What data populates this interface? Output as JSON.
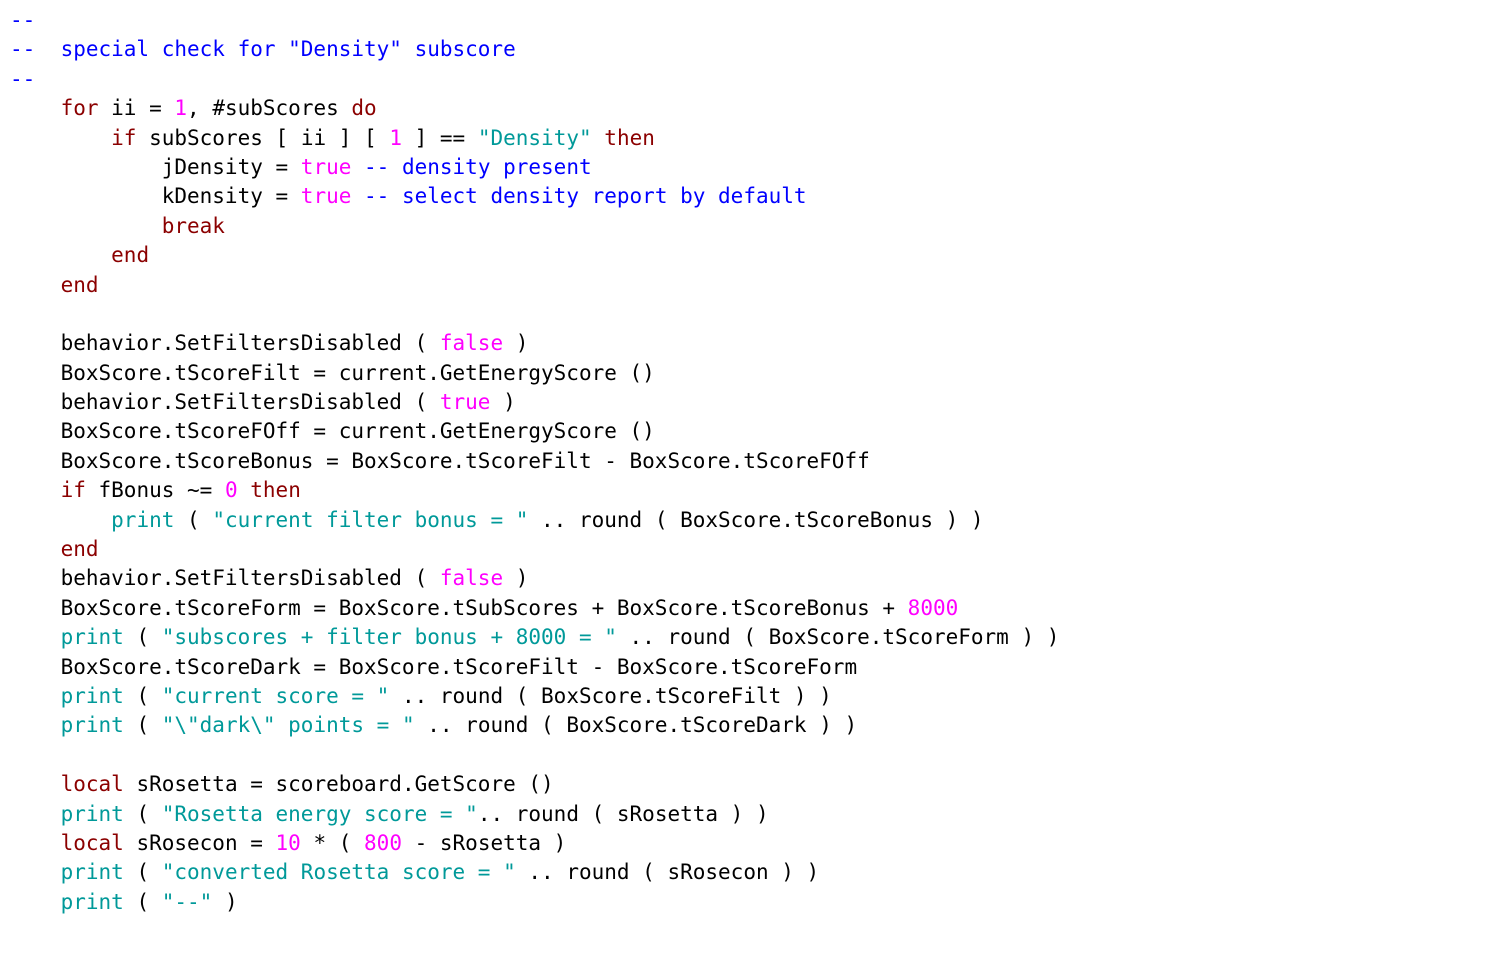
{
  "tokens": [
    {
      "cls": "c-blue",
      "text": "--"
    },
    {
      "br": true
    },
    {
      "cls": "c-blue",
      "text": "--  special check for \"Density\" subscore"
    },
    {
      "br": true
    },
    {
      "cls": "c-blue",
      "text": "--"
    },
    {
      "br": true
    },
    {
      "cls": "c-black",
      "text": "    "
    },
    {
      "cls": "c-brown",
      "text": "for"
    },
    {
      "cls": "c-black",
      "text": " ii = "
    },
    {
      "cls": "c-mag",
      "text": "1"
    },
    {
      "cls": "c-black",
      "text": ", #subScores "
    },
    {
      "cls": "c-brown",
      "text": "do"
    },
    {
      "br": true
    },
    {
      "cls": "c-black",
      "text": "        "
    },
    {
      "cls": "c-brown",
      "text": "if"
    },
    {
      "cls": "c-black",
      "text": " subScores [ ii ] [ "
    },
    {
      "cls": "c-mag",
      "text": "1"
    },
    {
      "cls": "c-black",
      "text": " ] == "
    },
    {
      "cls": "c-teal",
      "text": "\"Density\""
    },
    {
      "cls": "c-black",
      "text": " "
    },
    {
      "cls": "c-brown",
      "text": "then"
    },
    {
      "br": true
    },
    {
      "cls": "c-black",
      "text": "            jDensity = "
    },
    {
      "cls": "c-mag",
      "text": "true"
    },
    {
      "cls": "c-black",
      "text": " "
    },
    {
      "cls": "c-blue",
      "text": "-- density present"
    },
    {
      "br": true
    },
    {
      "cls": "c-black",
      "text": "            kDensity = "
    },
    {
      "cls": "c-mag",
      "text": "true"
    },
    {
      "cls": "c-black",
      "text": " "
    },
    {
      "cls": "c-blue",
      "text": "-- select density report by default"
    },
    {
      "br": true
    },
    {
      "cls": "c-black",
      "text": "            "
    },
    {
      "cls": "c-brown",
      "text": "break"
    },
    {
      "br": true
    },
    {
      "cls": "c-black",
      "text": "        "
    },
    {
      "cls": "c-brown",
      "text": "end"
    },
    {
      "br": true
    },
    {
      "cls": "c-black",
      "text": "    "
    },
    {
      "cls": "c-brown",
      "text": "end"
    },
    {
      "br": true
    },
    {
      "br": true
    },
    {
      "cls": "c-black",
      "text": "    behavior.SetFiltersDisabled ( "
    },
    {
      "cls": "c-mag",
      "text": "false"
    },
    {
      "cls": "c-black",
      "text": " )"
    },
    {
      "br": true
    },
    {
      "cls": "c-black",
      "text": "    BoxScore.tScoreFilt = current.GetEnergyScore ()"
    },
    {
      "br": true
    },
    {
      "cls": "c-black",
      "text": "    behavior.SetFiltersDisabled ( "
    },
    {
      "cls": "c-mag",
      "text": "true"
    },
    {
      "cls": "c-black",
      "text": " )"
    },
    {
      "br": true
    },
    {
      "cls": "c-black",
      "text": "    BoxScore.tScoreFOff = current.GetEnergyScore ()"
    },
    {
      "br": true
    },
    {
      "cls": "c-black",
      "text": "    BoxScore.tScoreBonus = BoxScore.tScoreFilt - BoxScore.tScoreFOff"
    },
    {
      "br": true
    },
    {
      "cls": "c-black",
      "text": "    "
    },
    {
      "cls": "c-brown",
      "text": "if"
    },
    {
      "cls": "c-black",
      "text": " fBonus ~= "
    },
    {
      "cls": "c-mag",
      "text": "0"
    },
    {
      "cls": "c-black",
      "text": " "
    },
    {
      "cls": "c-brown",
      "text": "then"
    },
    {
      "br": true
    },
    {
      "cls": "c-black",
      "text": "        "
    },
    {
      "cls": "c-teal",
      "text": "print"
    },
    {
      "cls": "c-black",
      "text": " ( "
    },
    {
      "cls": "c-teal",
      "text": "\"current filter bonus = \""
    },
    {
      "cls": "c-black",
      "text": " .. round ( BoxScore.tScoreBonus ) )"
    },
    {
      "br": true
    },
    {
      "cls": "c-black",
      "text": "    "
    },
    {
      "cls": "c-brown",
      "text": "end"
    },
    {
      "br": true
    },
    {
      "cls": "c-black",
      "text": "    behavior.SetFiltersDisabled ( "
    },
    {
      "cls": "c-mag",
      "text": "false"
    },
    {
      "cls": "c-black",
      "text": " )"
    },
    {
      "br": true
    },
    {
      "cls": "c-black",
      "text": "    BoxScore.tScoreForm = BoxScore.tSubScores + BoxScore.tScoreBonus + "
    },
    {
      "cls": "c-mag",
      "text": "8000"
    },
    {
      "br": true
    },
    {
      "cls": "c-black",
      "text": "    "
    },
    {
      "cls": "c-teal",
      "text": "print"
    },
    {
      "cls": "c-black",
      "text": " ( "
    },
    {
      "cls": "c-teal",
      "text": "\"subscores + filter bonus + 8000 = \""
    },
    {
      "cls": "c-black",
      "text": " .. round ( BoxScore.tScoreForm ) )"
    },
    {
      "br": true
    },
    {
      "cls": "c-black",
      "text": "    BoxScore.tScoreDark = BoxScore.tScoreFilt - BoxScore.tScoreForm"
    },
    {
      "br": true
    },
    {
      "cls": "c-black",
      "text": "    "
    },
    {
      "cls": "c-teal",
      "text": "print"
    },
    {
      "cls": "c-black",
      "text": " ( "
    },
    {
      "cls": "c-teal",
      "text": "\"current score = \""
    },
    {
      "cls": "c-black",
      "text": " .. round ( BoxScore.tScoreFilt ) )"
    },
    {
      "br": true
    },
    {
      "cls": "c-black",
      "text": "    "
    },
    {
      "cls": "c-teal",
      "text": "print"
    },
    {
      "cls": "c-black",
      "text": " ( "
    },
    {
      "cls": "c-teal",
      "text": "\"\\\"dark\\\" points = \""
    },
    {
      "cls": "c-black",
      "text": " .. round ( BoxScore.tScoreDark ) )"
    },
    {
      "br": true
    },
    {
      "br": true
    },
    {
      "cls": "c-black",
      "text": "    "
    },
    {
      "cls": "c-brown",
      "text": "local"
    },
    {
      "cls": "c-black",
      "text": " sRosetta = scoreboard.GetScore ()"
    },
    {
      "br": true
    },
    {
      "cls": "c-black",
      "text": "    "
    },
    {
      "cls": "c-teal",
      "text": "print"
    },
    {
      "cls": "c-black",
      "text": " ( "
    },
    {
      "cls": "c-teal",
      "text": "\"Rosetta energy score = \""
    },
    {
      "cls": "c-black",
      "text": ".. round ( sRosetta ) )"
    },
    {
      "br": true
    },
    {
      "cls": "c-black",
      "text": "    "
    },
    {
      "cls": "c-brown",
      "text": "local"
    },
    {
      "cls": "c-black",
      "text": " sRosecon = "
    },
    {
      "cls": "c-mag",
      "text": "10"
    },
    {
      "cls": "c-black",
      "text": " * ( "
    },
    {
      "cls": "c-mag",
      "text": "800"
    },
    {
      "cls": "c-black",
      "text": " - sRosetta )"
    },
    {
      "br": true
    },
    {
      "cls": "c-black",
      "text": "    "
    },
    {
      "cls": "c-teal",
      "text": "print"
    },
    {
      "cls": "c-black",
      "text": " ( "
    },
    {
      "cls": "c-teal",
      "text": "\"converted Rosetta score = \""
    },
    {
      "cls": "c-black",
      "text": " .. round ( sRosecon ) )"
    },
    {
      "br": true
    },
    {
      "cls": "c-black",
      "text": "    "
    },
    {
      "cls": "c-teal",
      "text": "print"
    },
    {
      "cls": "c-black",
      "text": " ( "
    },
    {
      "cls": "c-teal",
      "text": "\"--\""
    },
    {
      "cls": "c-black",
      "text": " )"
    }
  ]
}
